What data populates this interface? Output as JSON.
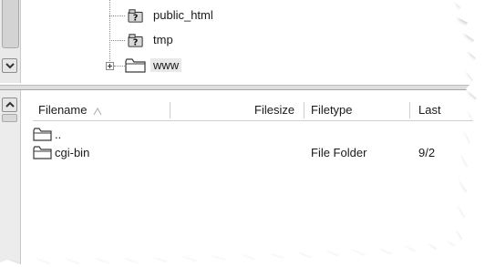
{
  "tree": {
    "items": [
      {
        "label": "public_html",
        "icon": "question-folder-icon"
      },
      {
        "label": "tmp",
        "icon": "question-folder-icon"
      },
      {
        "label": "www",
        "icon": "folder-icon"
      }
    ]
  },
  "file_list": {
    "columns": [
      "Filename",
      "Filesize",
      "Filetype",
      "Last"
    ],
    "sort_indicator": "▲",
    "rows": [
      {
        "filename": "..",
        "filesize": "",
        "filetype": "",
        "last": ""
      },
      {
        "filename": "cgi-bin",
        "filesize": "",
        "filetype": "File Folder",
        "last": "9/2"
      }
    ]
  },
  "colors": {
    "background": "#ffffff",
    "scrollbar": "#e9e9e9",
    "selection": "#e9e9e9"
  }
}
